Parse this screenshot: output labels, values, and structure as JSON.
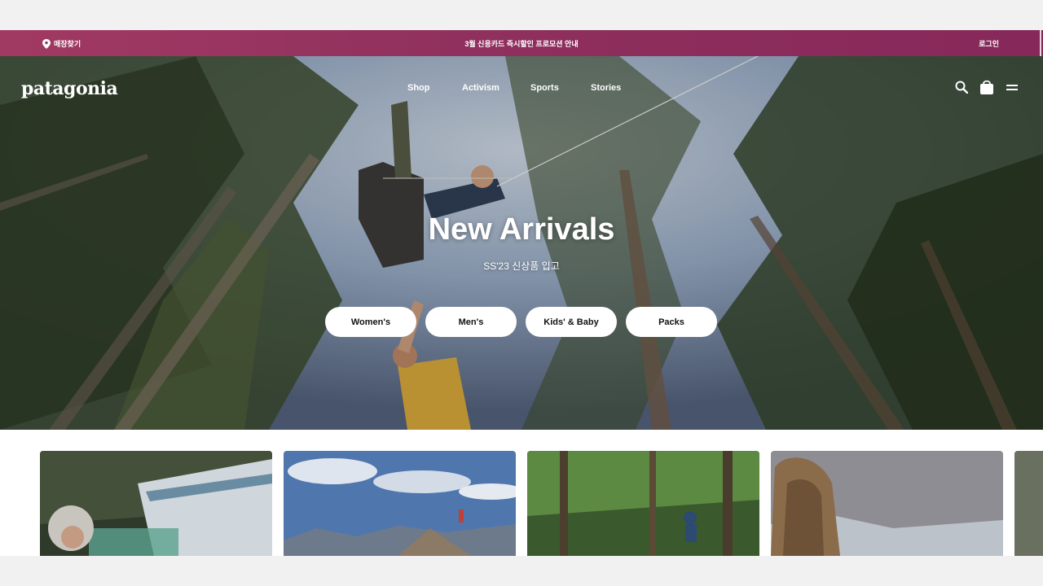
{
  "promo": {
    "store_finder": "매장찾기",
    "announcement": "3월 신용카드 즉시할인 프로모션 안내",
    "login": "로그인"
  },
  "header": {
    "logo": "patagonia",
    "nav": [
      "Shop",
      "Activism",
      "Sports",
      "Stories"
    ],
    "icons": [
      "search-icon",
      "bag-icon",
      "menu-icon"
    ]
  },
  "hero": {
    "title": "New Arrivals",
    "subtitle": "SS'23 신상품 입고",
    "buttons": [
      "Women's",
      "Men's",
      "Kids' & Baby",
      "Packs"
    ]
  },
  "colors": {
    "promo_bar": "#8e2f5d",
    "button_bg": "#ffffff",
    "text_light": "#ffffff"
  }
}
